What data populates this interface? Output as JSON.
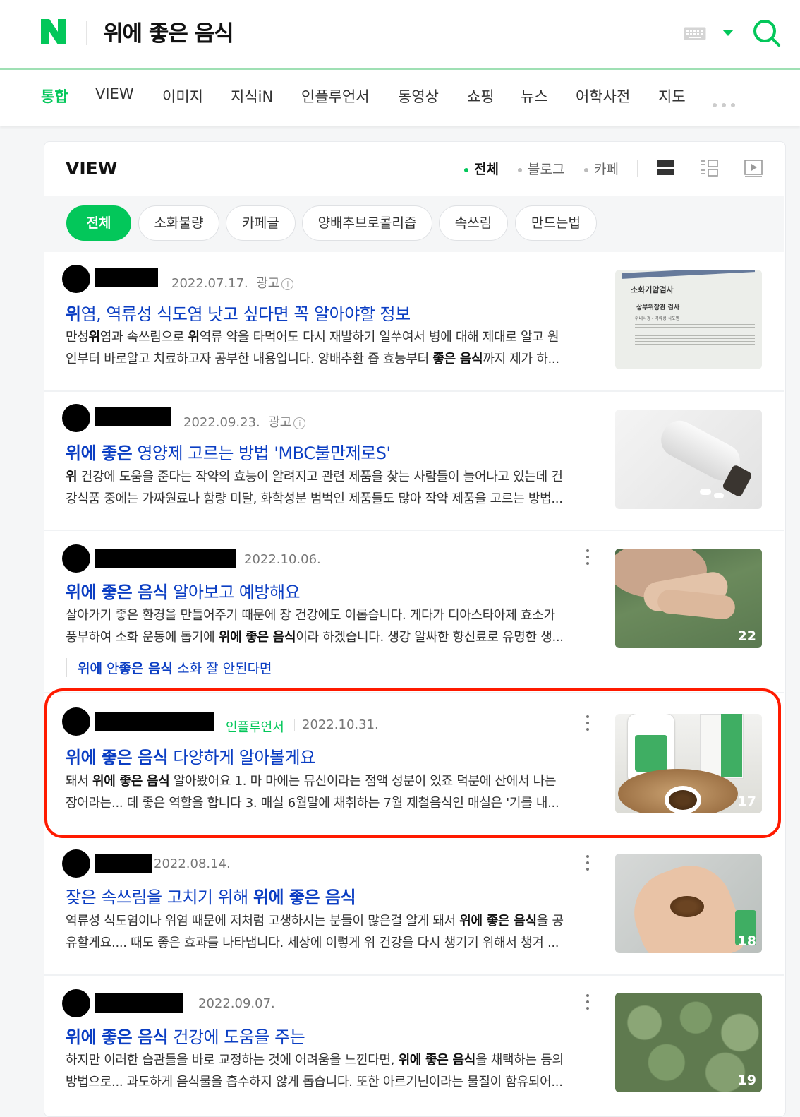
{
  "header": {
    "logo": "N",
    "query": "위에 좋은 음식",
    "keyboard_icon": "keyboard-icon",
    "dropdown_icon": "caret-down-icon",
    "search_icon": "search-icon"
  },
  "tabs": [
    "통합",
    "VIEW",
    "이미지",
    "지식iN",
    "인플루언서",
    "동영상",
    "쇼핑",
    "뉴스",
    "어학사전",
    "지도"
  ],
  "view": {
    "title": "VIEW",
    "filters": [
      "전체",
      "블로그",
      "카페"
    ],
    "chips": [
      "전체",
      "소화불량",
      "카페글",
      "양배추브로콜리즙",
      "속쓰림",
      "만드는법"
    ]
  },
  "results": [
    {
      "date": "2022.07.17.",
      "ad": "광고",
      "title_parts": [
        {
          "t": "위",
          "b": true
        },
        {
          "t": "염, 역류성 식도염 낫고 싶다면 꼭 알아야할 정보",
          "b": false
        }
      ],
      "desc1": [
        {
          "t": "만성",
          "b": false
        },
        {
          "t": "위",
          "b": true
        },
        {
          "t": "염과 속쓰림으로 ",
          "b": false
        },
        {
          "t": "위",
          "b": true
        },
        {
          "t": "역류 약을 타먹어도 다시 재발하기 일쑤여서 병에 대해 제대로 알고 원",
          "b": false
        }
      ],
      "desc2": [
        {
          "t": "인부터 바로알고 치료하고자 공부한 내용입니다. 양배추환 즙 효능부터 ",
          "b": false
        },
        {
          "t": "좋은 음식",
          "b": true
        },
        {
          "t": "까지 제가 하...",
          "b": false
        }
      ],
      "thumb_text": [
        "소화기암검사",
        "상부위장관 검사",
        "위내시경 - 역류성 식도염"
      ]
    },
    {
      "date": "2022.09.23.",
      "ad": "광고",
      "title_parts": [
        {
          "t": "위에 좋은",
          "b": true
        },
        {
          "t": " 영양제 고르는 방법 'MBC불만제로S'",
          "b": false
        }
      ],
      "desc1": [
        {
          "t": "위",
          "b": true
        },
        {
          "t": " 건강에 도움을 준다는 작약의 효능이 알려지고 관련 제품을 찾는 사람들이 늘어나고 있는데 건",
          "b": false
        }
      ],
      "desc2": [
        {
          "t": "강식품 중에는 가짜원료나 함량 미달, 화학성분 범벅인 제품들도 많아 작약 제품을 고르는 방법...",
          "b": false
        }
      ]
    },
    {
      "date": "2022.10.06.",
      "title_parts": [
        {
          "t": "위에 좋은 음식",
          "b": true
        },
        {
          "t": " 알아보고 예방해요",
          "b": false
        }
      ],
      "desc1": [
        {
          "t": "살아가기 좋은 환경을 만들어주기 때문에 장 건강에도 이롭습니다. 게다가 디아스타아제 효소가",
          "b": false
        }
      ],
      "desc2": [
        {
          "t": "풍부하여 소화 운동에 돕기에 ",
          "b": false
        },
        {
          "t": "위에 좋은 음식",
          "b": true
        },
        {
          "t": "이라 하겠습니다. 생강 알싸한 향신료로 유명한 생...",
          "b": false
        }
      ],
      "sublink": [
        {
          "t": "위에",
          "b": true
        },
        {
          "t": " 안",
          "b": false
        },
        {
          "t": "좋은 음식",
          "b": true
        },
        {
          "t": " 소화 잘 안된다면",
          "b": false
        }
      ],
      "count": "22"
    },
    {
      "badge": "인플루언서",
      "date": "2022.10.31.",
      "title_parts": [
        {
          "t": "위에 좋은 음식",
          "b": true
        },
        {
          "t": " 다양하게 알아볼게요",
          "b": false
        }
      ],
      "desc1": [
        {
          "t": "돼서 ",
          "b": false
        },
        {
          "t": "위에 좋은 음식",
          "b": true
        },
        {
          "t": " 알아봤어요 1. 마 마에는 뮤신이라는 점액 성분이 있죠 덕분에 산에서 나는",
          "b": false
        }
      ],
      "desc2": [
        {
          "t": "장어라는... 데 좋은 역할을 합니다 3. 매실 6월말에 채취하는 7월 제철음식인 매실은 '기를 내...",
          "b": false
        }
      ],
      "count": "17"
    },
    {
      "date": "2022.08.14.",
      "title_parts": [
        {
          "t": "잦은 속쓰림을 고치기 위해 ",
          "b": false
        },
        {
          "t": "위에 좋은 음식",
          "b": true
        }
      ],
      "desc1": [
        {
          "t": "역류성 식도염이나 위염 때문에 저처럼 고생하시는 분들이 많은걸 알게 돼서 ",
          "b": false
        },
        {
          "t": "위에 좋은 음식",
          "b": true
        },
        {
          "t": "을 공",
          "b": false
        }
      ],
      "desc2": [
        {
          "t": "유할게요.... 때도 좋은 효과를 나타냅니다. 세상에 이렇게 위 건강을 다시 챙기기 위해서 챙겨 ...",
          "b": false
        }
      ],
      "count": "18"
    },
    {
      "date": "2022.09.07.",
      "title_parts": [
        {
          "t": "위에 좋은 음식",
          "b": true
        },
        {
          "t": " 건강에 도움을 주는",
          "b": false
        }
      ],
      "desc1": [
        {
          "t": "하지만 이러한 습관들을 바로 교정하는 것에 어려움을 느낀다면, ",
          "b": false
        },
        {
          "t": "위에 좋은 음식",
          "b": true
        },
        {
          "t": "을 채택하는 등의",
          "b": false
        }
      ],
      "desc2": [
        {
          "t": "방법으로... 과도하게 음식물을 흡수하지 않게 돕습니다. 또한 아르기닌이라는 물질이 함유되어...",
          "b": false
        }
      ],
      "count": "19"
    }
  ],
  "colors": {
    "brand": "#03c75a",
    "link": "#0b3ec3",
    "highlight": "#ff1a00"
  }
}
